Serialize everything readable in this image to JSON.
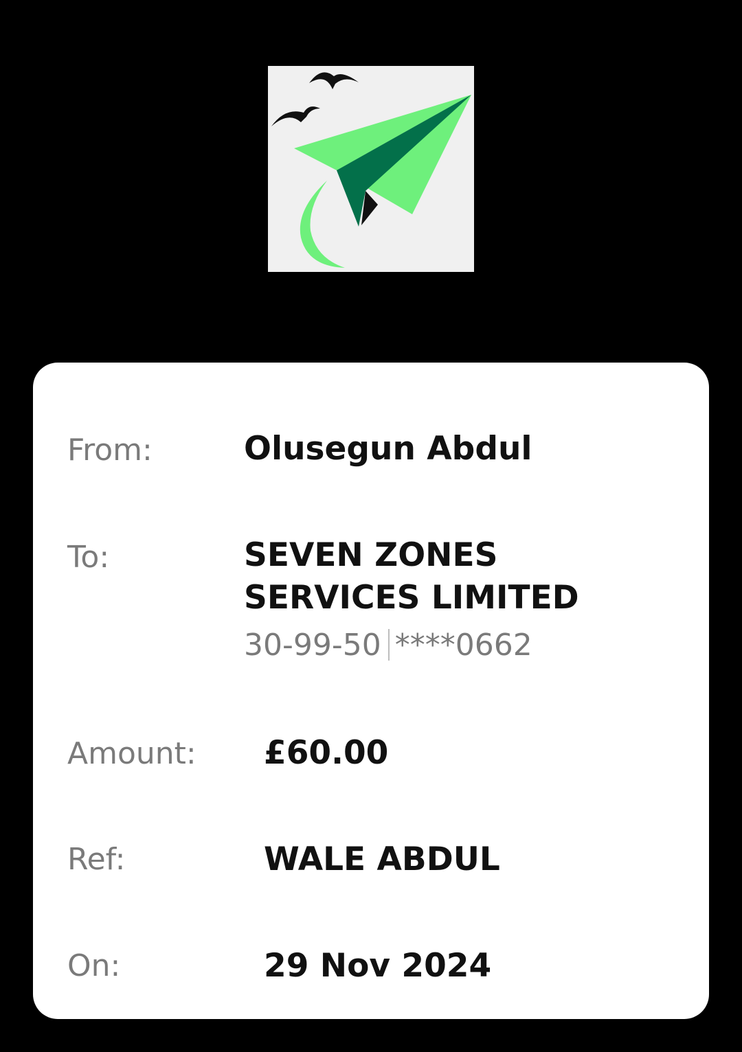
{
  "logo": {
    "name": "paper-plane-logo",
    "colors": {
      "background": "#f0f0f0",
      "plane_light": "#6ef07c",
      "plane_dark": "#03704a",
      "birds": "#111111"
    }
  },
  "payment": {
    "from_label": "From:",
    "from_value": "Olusegun Abdul",
    "to_label": "To:",
    "to_value": "SEVEN ZONES SERVICES LIMITED",
    "sort_code": "30-99-50",
    "account_masked": "****0662",
    "amount_label": "Amount:",
    "amount_value": "£60.00",
    "ref_label": "Ref:",
    "ref_value": "WALE ABDUL",
    "date_label": "On:",
    "date_value": "29 Nov 2024"
  },
  "colors": {
    "page_background": "#000000",
    "card_background": "#ffffff",
    "label_text": "#7a7a7a",
    "value_text": "#111111"
  }
}
